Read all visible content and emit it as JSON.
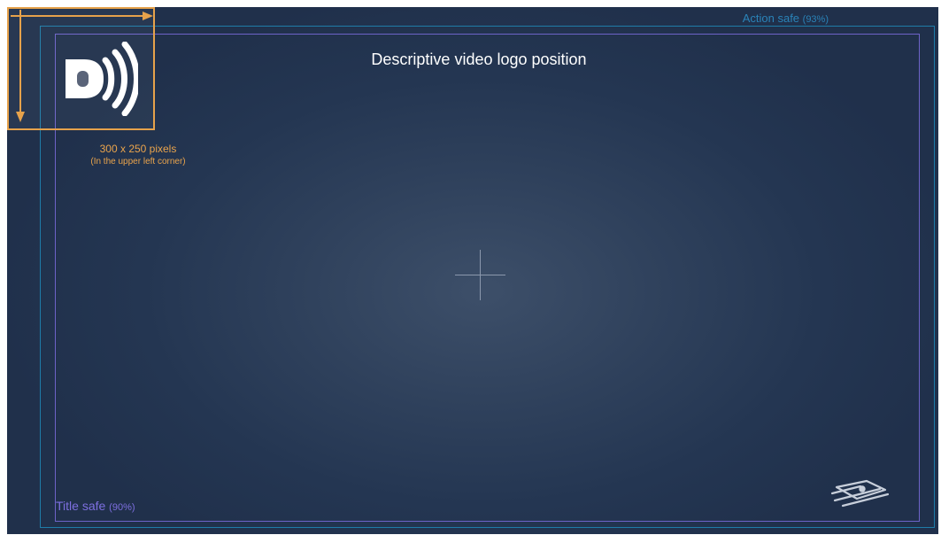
{
  "diagram": {
    "title": "Descriptive video logo position",
    "action_safe": {
      "label_text": "Action safe ",
      "label_pct": "(93%)"
    },
    "title_safe": {
      "label_text": "Title safe ",
      "label_pct": "(90%)"
    },
    "logo_area": {
      "icon": "descriptive-video-logo",
      "size_label": "300 x 250 pixels",
      "position_label": "(In the upper left corner)"
    },
    "center_marker": {
      "icon": "crosshair"
    },
    "watermark": {
      "icon": "broadcast-logo-watermark"
    },
    "colors": {
      "background": "#243652",
      "action_safe": "#1f7ca8",
      "title_safe": "#6d63c8",
      "logo_area": "#e6a24b",
      "text": "#ffffff"
    }
  }
}
